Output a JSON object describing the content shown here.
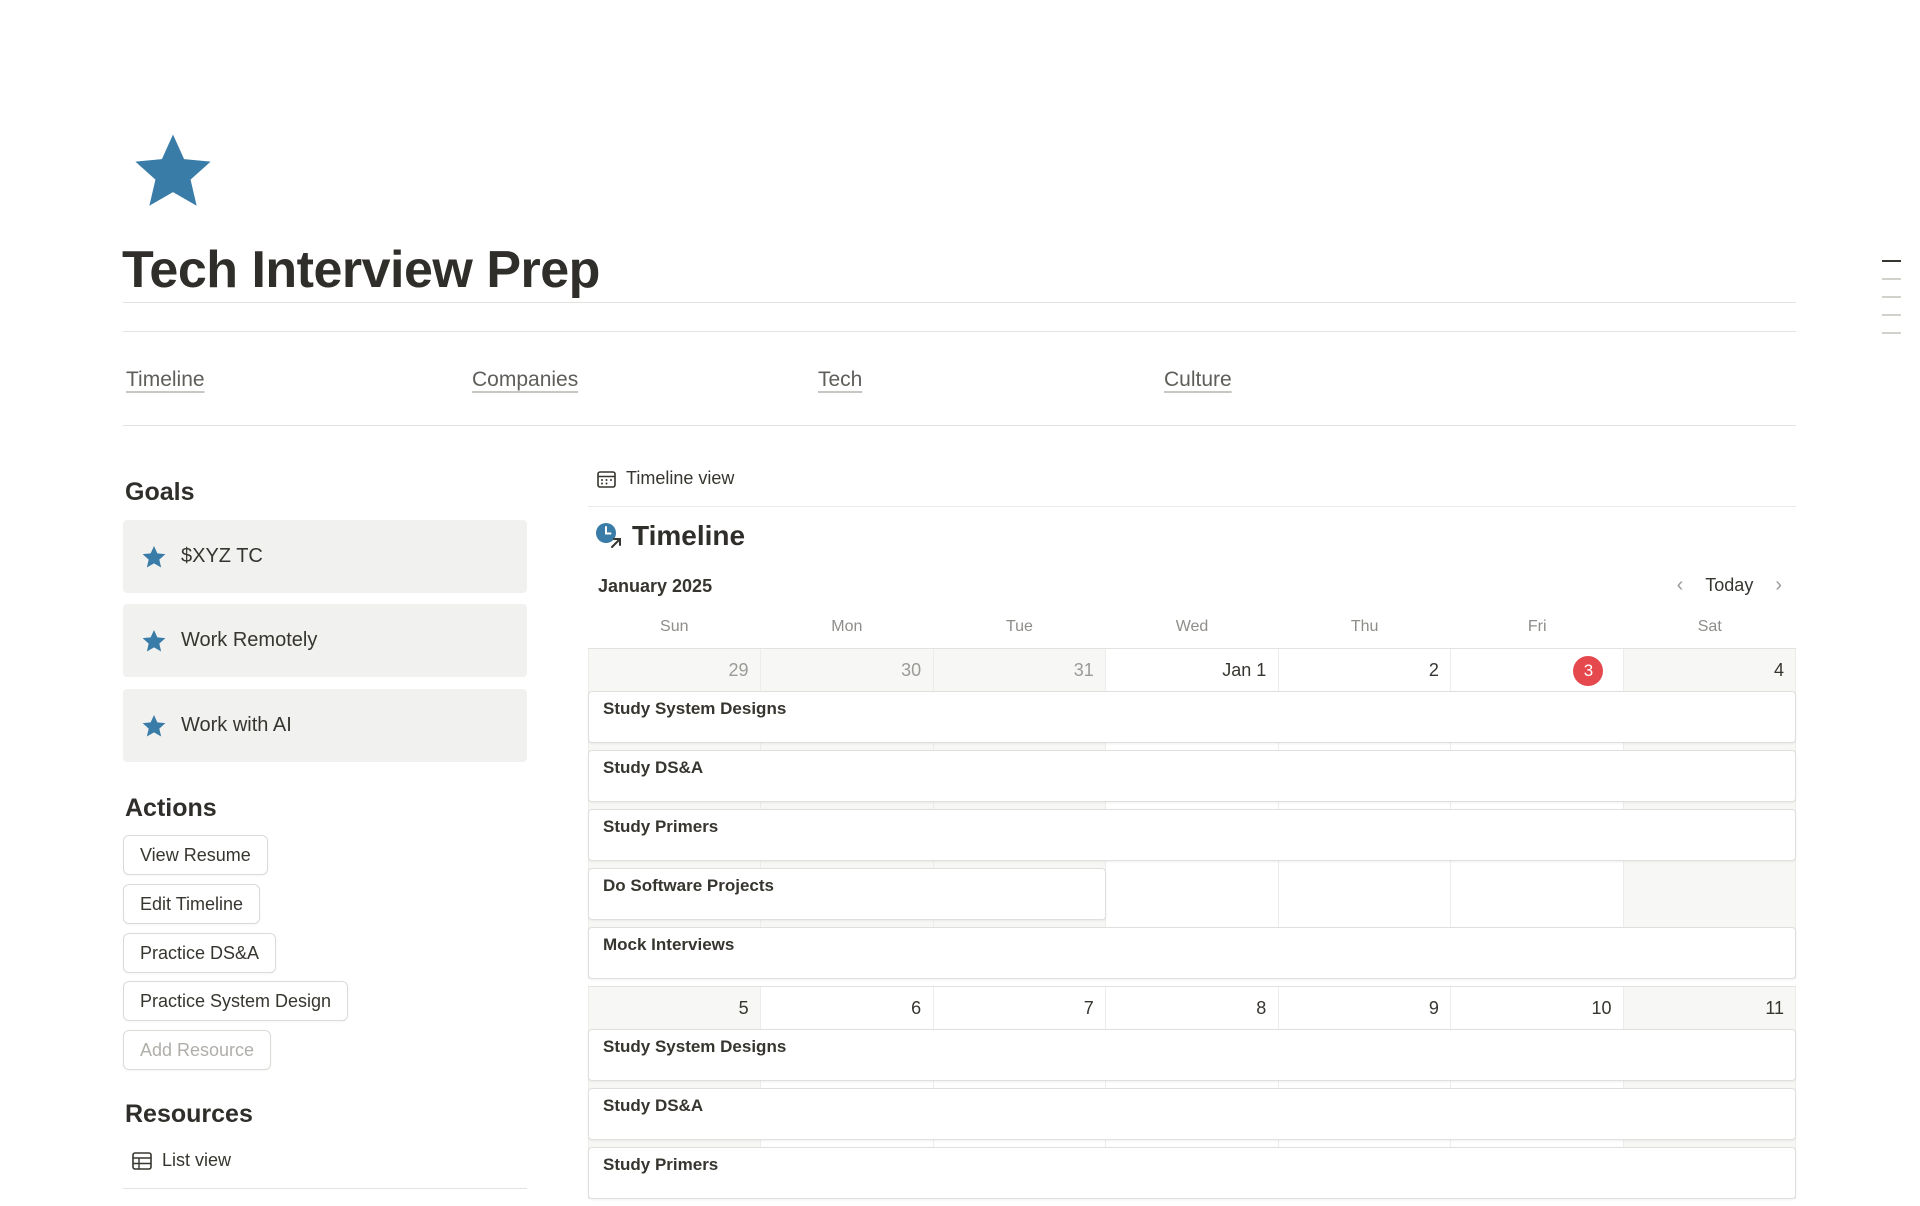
{
  "page": {
    "title": "Tech Interview Prep",
    "icon": "star-icon",
    "icon_color": "#3a7ca8"
  },
  "tabs": [
    {
      "label": "Timeline"
    },
    {
      "label": "Companies"
    },
    {
      "label": "Tech"
    },
    {
      "label": "Culture"
    }
  ],
  "goals": {
    "heading": "Goals",
    "items": [
      {
        "label": "$XYZ TC"
      },
      {
        "label": "Work Remotely"
      },
      {
        "label": "Work with AI"
      }
    ]
  },
  "actions": {
    "heading": "Actions",
    "buttons": [
      {
        "label": "View Resume"
      },
      {
        "label": "Edit Timeline"
      },
      {
        "label": "Practice DS&A"
      },
      {
        "label": "Practice System Design"
      },
      {
        "label": "Add Resource"
      }
    ]
  },
  "resources": {
    "heading": "Resources",
    "view_label": "List view"
  },
  "timeline": {
    "view_label": "Timeline view",
    "title": "Timeline",
    "month": "January 2025",
    "today_label": "Today",
    "weekdays": [
      "Sun",
      "Mon",
      "Tue",
      "Wed",
      "Thu",
      "Fri",
      "Sat"
    ],
    "today_color": "#e5484d",
    "weeks": [
      {
        "days": [
          "29",
          "30",
          "31",
          "Jan 1",
          "2",
          "3",
          "4"
        ],
        "events": [
          "Study System Designs",
          "Study DS&A",
          "Study Primers",
          "Do Software Projects",
          "Mock Interviews"
        ]
      },
      {
        "days": [
          "5",
          "6",
          "7",
          "8",
          "9",
          "10",
          "11"
        ],
        "events": [
          "Study System Designs",
          "Study DS&A",
          "Study Primers"
        ]
      }
    ]
  }
}
